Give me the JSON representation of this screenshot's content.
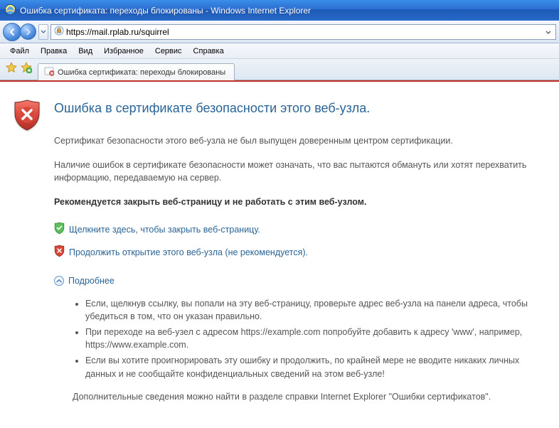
{
  "window": {
    "title": "Ошибка сертификата: переходы блокированы - Windows Internet Explorer"
  },
  "address": {
    "url": "https://mail.rplab.ru/squirrel"
  },
  "menus": {
    "file": "Файл",
    "edit": "Правка",
    "view": "Вид",
    "favorites": "Избранное",
    "tools": "Сервис",
    "help": "Справка"
  },
  "tab": {
    "title": "Ошибка сертификата: переходы блокированы"
  },
  "page": {
    "heading": "Ошибка в сертификате безопасности этого веб-узла.",
    "p1": "Сертификат безопасности этого веб-узла не был выпущен доверенным центром сертификации.",
    "p2": "Наличие ошибок в сертификате безопасности может означать, что вас пытаются обмануть или хотят перехватить информацию, передаваемую на сервер.",
    "recommend": "Рекомендуется закрыть веб-страницу и не работать с этим веб-узлом.",
    "close_link": "Щелкните здесь, чтобы закрыть веб-страницу.",
    "continue_link": "Продолжить открытие этого веб-узла (не рекомендуется).",
    "more_label": "Подробнее",
    "bullet1": "Если, щелкнув ссылку, вы попали на эту веб-страницу, проверьте адрес веб-узла на панели адреса, чтобы убедиться в том, что он указан правильно.",
    "bullet2": "При переходе на веб-узел с адресом https://example.com попробуйте добавить к адресу 'www', например, https://www.example.com.",
    "bullet3": "Если вы хотите проигнорировать эту ошибку и продолжить, по крайней мере не вводите никаких личных данных и не сообщайте конфиденциальных сведений на этом веб-узле!",
    "footer": "Дополнительные сведения можно найти в разделе справки Internet Explorer \"Ошибки сертификатов\"."
  }
}
